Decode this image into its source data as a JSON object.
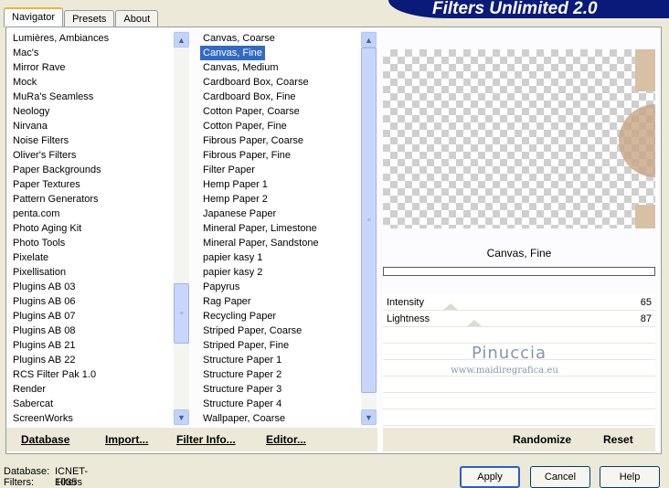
{
  "tabs": [
    "Navigator",
    "Presets",
    "About"
  ],
  "banner_title": "Filters Unlimited 2.0",
  "categories": [
    "Lumières, Ambiances",
    "Mac's",
    "Mirror Rave",
    "Mock",
    "MuRa's Seamless",
    "Neology",
    "Nirvana",
    "Noise Filters",
    "Oliver's Filters",
    "Paper Backgrounds",
    "Paper Textures",
    "Pattern Generators",
    "penta.com",
    "Photo Aging Kit",
    "Photo Tools",
    "Pixelate",
    "Pixellisation",
    "Plugins AB 03",
    "Plugins AB 06",
    "Plugins AB 07",
    "Plugins AB 08",
    "Plugins AB 21",
    "Plugins AB 22",
    "RCS Filter Pak 1.0",
    "Render",
    "Sabercat",
    "ScreenWorks"
  ],
  "selected_category": "Paper Textures",
  "filters": [
    "Canvas, Coarse",
    "Canvas, Fine",
    "Canvas, Medium",
    "Cardboard Box, Coarse",
    "Cardboard Box, Fine",
    "Cotton Paper, Coarse",
    "Cotton Paper, Fine",
    "Fibrous Paper, Coarse",
    "Fibrous Paper, Fine",
    "Filter Paper",
    "Hemp Paper 1",
    "Hemp Paper 2",
    "Japanese Paper",
    "Mineral Paper, Limestone",
    "Mineral Paper, Sandstone",
    "papier kasy 1",
    "papier kasy 2",
    "Papyrus",
    "Rag Paper",
    "Recycling Paper",
    "Striped Paper, Coarse",
    "Striped Paper, Fine",
    "Structure Paper 1",
    "Structure Paper 2",
    "Structure Paper 3",
    "Structure Paper 4",
    "Wallpaper, Coarse"
  ],
  "selected_filter": "Canvas, Fine",
  "filter_name": "Canvas, Fine",
  "params": [
    {
      "label": "Intensity",
      "value": "65"
    },
    {
      "label": "Lightness",
      "value": "87"
    }
  ],
  "watermark": "Pinuccia",
  "watermark_sub": "www.maidiregrafica.eu",
  "actions_left": [
    "Database",
    "Import...",
    "Filter Info...",
    "Editor..."
  ],
  "actions_right": [
    "Randomize",
    "Reset"
  ],
  "status": {
    "database_label": "Database:",
    "database_value": "ICNET-Filters",
    "filters_label": "Filters:",
    "filters_value": "1035"
  },
  "buttons": {
    "apply": "Apply",
    "cancel": "Cancel",
    "help": "Help"
  }
}
